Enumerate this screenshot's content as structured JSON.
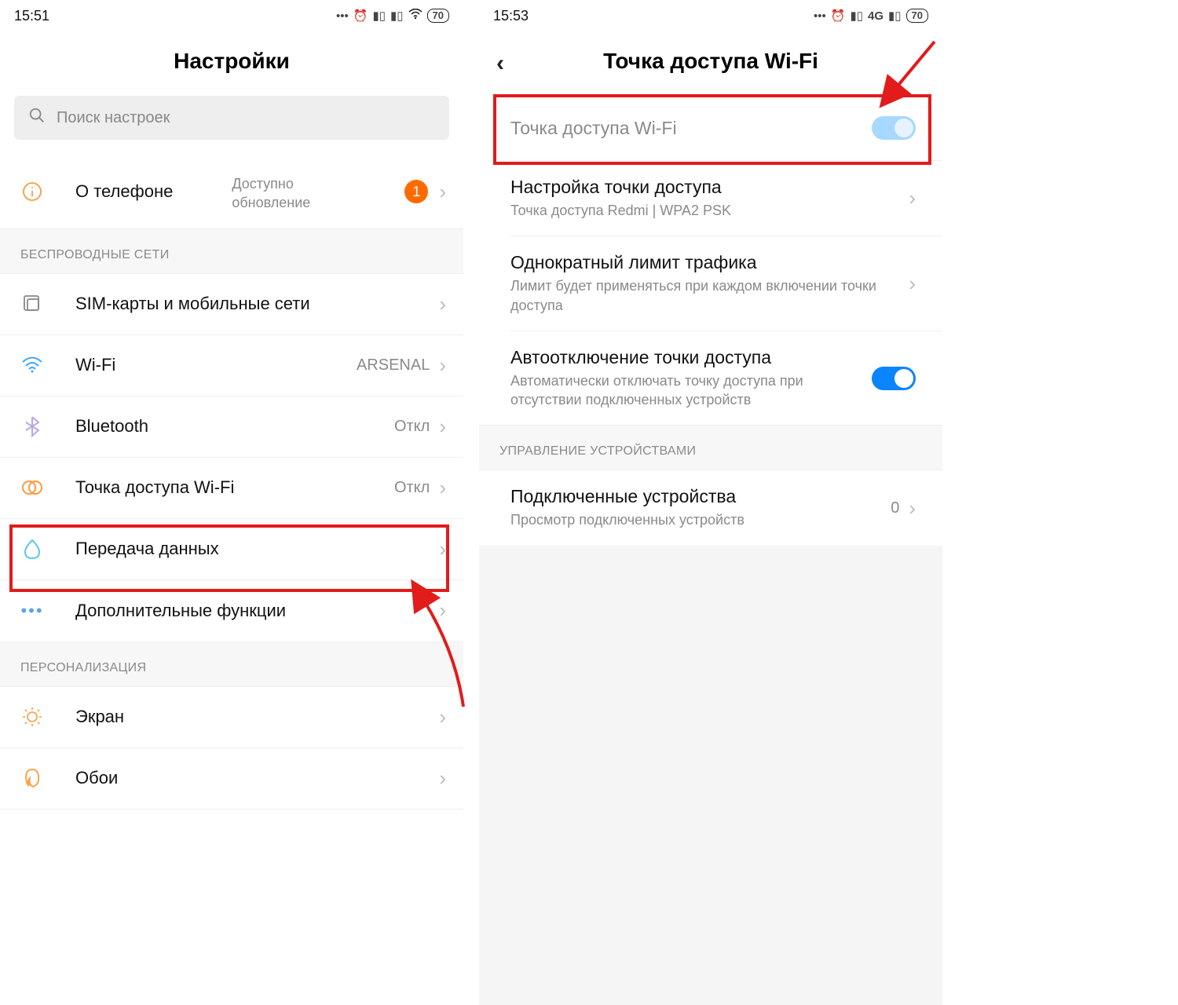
{
  "left": {
    "time": "15:51",
    "battery": "70",
    "title": "Настройки",
    "search_placeholder": "Поиск настроек",
    "about": {
      "label": "О телефоне",
      "sub": "Доступно обновление",
      "badge": "1"
    },
    "section_wireless": "БЕСПРОВОДНЫЕ СЕТИ",
    "sim": "SIM-карты и мобильные сети",
    "wifi": {
      "label": "Wi-Fi",
      "value": "ARSENAL"
    },
    "bt": {
      "label": "Bluetooth",
      "value": "Откл"
    },
    "hotspot": {
      "label": "Точка доступа Wi-Fi",
      "value": "Откл"
    },
    "data": "Передача данных",
    "more": "Дополнительные функции",
    "section_personal": "ПЕРСОНАЛИЗАЦИЯ",
    "display": "Экран",
    "wallpaper": "Обои"
  },
  "right": {
    "time": "15:53",
    "battery": "70",
    "net": "4G",
    "title": "Точка доступа Wi-Fi",
    "toggle_label": "Точка доступа Wi-Fi",
    "setup": {
      "label": "Настройка точки доступа",
      "sub": "Точка доступа Redmi | WPA2 PSK"
    },
    "limit": {
      "label": "Однократный лимит трафика",
      "sub": "Лимит будет применяться при каждом включении точки доступа"
    },
    "auto_off": {
      "label": "Автоотключение точки доступа",
      "sub": "Автоматически отключать точку доступа при отсутствии подключенных устройств"
    },
    "section_devices": "УПРАВЛЕНИЕ УСТРОЙСТВАМИ",
    "connected": {
      "label": "Подключенные устройства",
      "sub": "Просмотр подключенных устройств",
      "count": "0"
    }
  },
  "colors": {
    "accent_orange": "#ff6a00",
    "accent_blue": "#0a84ff",
    "annotation_red": "#e21b1b"
  }
}
